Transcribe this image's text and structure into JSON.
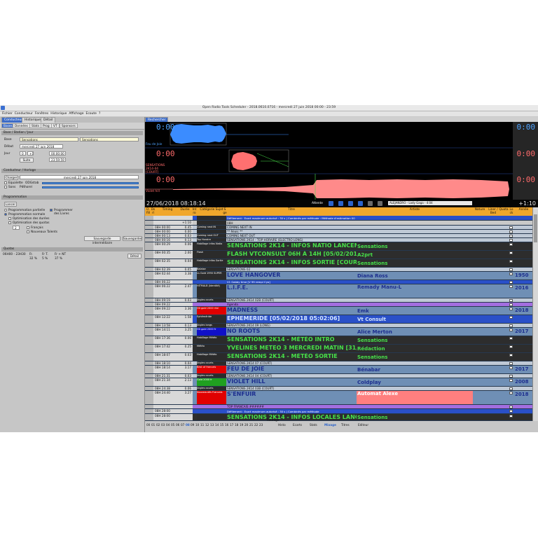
{
  "window": {
    "title": "Open Radio Tools Scheduler - 2018.0610.0716 - mercredi 27 juin 2018  00:00 - 23:59"
  },
  "menu": [
    "Fichier",
    "Conducteur",
    "Fenêtres",
    "Historique",
    "Affichage",
    "Ecoute",
    "?"
  ],
  "left": {
    "tabs": [
      "Conducteur",
      "Historique",
      "Détail"
    ],
    "subtabs": [
      "Bases",
      "Données",
      "Stats",
      "Prog",
      "VT",
      "Sponsors"
    ],
    "base_section": "Base / Station / Jour",
    "base_label": "Base",
    "base_value": "Sensations",
    "station_value": "Sensations",
    "debut_label": "Début",
    "debut_date": "mercredi 27 juin 2018",
    "jour_label": "Jour",
    "jour_val1": "0",
    "jour_val2": "+1",
    "time1": "00:00:00",
    "suite_label": "Suite",
    "time2": "23:59:59",
    "cond_section": "Conducteur / Horloge",
    "charger_label": "Charger",
    "charger_date": "mercredi 27 juin 2018",
    "check1": "Equalette",
    "check1b": "ODGstab",
    "check2": "Sons",
    "check2b": "Pdthorel",
    "prog_section": "Programmation",
    "lancer_label": "Lancer",
    "opt_partielle": "Programmation partielle",
    "opt_normale": "Programmation normale",
    "opt_durees": "Optimisation des durées",
    "opt_quotas": "Optimisation des quotas",
    "opt_livres": "Programmer des Livres",
    "num_field": "2",
    "francais": "Français",
    "nouveaux": "Nouveaux Talents",
    "sauv_inter": "Sauvegarde intermédiaire",
    "sauv": "Sauvegarder",
    "quotas_section": "Quotas",
    "quota_rows": [
      {
        "range": "06H00 - 23H30",
        "fr": "Fr.",
        "ft": "Fr T.",
        "nt": "Fr + NT"
      },
      {
        "range": "",
        "fr": "32 %",
        "ft": "5 %",
        "nt": "37 %"
      }
    ],
    "detail_btn": "Détail"
  },
  "right": {
    "tabs": [
      "Rechercher"
    ],
    "tracks": [
      {
        "label": "Feu de Joie",
        "time": "0:00",
        "rtime": "0:00"
      },
      {
        "label": "SENSATIONS 2K14-04 [COURT]",
        "time": "0:00",
        "rtime": "0:00"
      },
      {
        "label": "Violet hill",
        "time": "0:00",
        "rtime": "0:00"
      }
    ],
    "clock": "27/06/2018 08:18:14",
    "attente": "Attente",
    "song": "ALEJANDRO - Lady Gaga - 4:04",
    "plus": "+1:10",
    "headers": {
      "d": "D. fill",
      "ds": "Ds rl",
      "timing": "Timing",
      "duree": "Durée",
      "intro": "Int ro",
      "cat": "Catégorie Sujet",
      "s": "S ge",
      "titre": "Titre",
      "artiste": "Artiste",
      "nature": "Nature",
      "liner": "Liner / Bed",
      "quota": "Quota",
      "lock": "Lo ck",
      "annee": "Année"
    },
    "rows": [
      {
        "time": "",
        "dur": "",
        "cat": "",
        "title": "Défilement : Ecart maximum autorisé : 30 s | Combinés par méthode : Méthode d'estimation 00",
        "artist": "",
        "year": ""
      },
      {
        "time": "",
        "dur": "+1:10",
        "cat": "",
        "title": "08H",
        "artist": "",
        "year": ""
      },
      {
        "time": "08H 00:00",
        "dur": "0.45",
        "cat": "Coming next IN",
        "title": "COMING NEXT IN",
        "artist": "",
        "year": ""
      },
      {
        "time": "08H 00:00",
        "dur": "0.00",
        "cat": "",
        "title": "** Réalc **",
        "artist": "",
        "year": ""
      },
      {
        "time": "08H 00:13",
        "dur": "0.03",
        "cat": "Coming next OUT",
        "title": "COMING NEXT OUT",
        "artist": "",
        "year": ""
      },
      {
        "time": "08H 00:16",
        "dur": "0.13",
        "cat": "Top Horaire",
        "title": "SENSATIONS 2K14 - TOP HORAIRE (ELECTRO LONG)",
        "artist": "",
        "year": ""
      },
      {
        "time": "08H 00:29",
        "dur": "0.06",
        "cat": "Habillage infos Natio",
        "title": "SENSATIONS 2K14 - INFOS NATIO LANCEMENT",
        "artist": "Sensations",
        "year": ""
      },
      {
        "time": "08H 00:35",
        "dur": "2.00",
        "cat": "Flash",
        "title": "FLASH VTCONSULT 06H À 14H [05/02/2018 11:42]",
        "artist": "A2prt",
        "year": ""
      },
      {
        "time": "08H 02:35",
        "dur": "0.04",
        "cat": "Habillage infos Sortie",
        "title": "SENSATIONS 2K14 - INFOS SORTIE [COURT]",
        "artist": "Sensations",
        "year": ""
      },
      {
        "time": "08H 02:39",
        "dur": "0.05",
        "cat": "Balaise",
        "title": "SENSATIONS 02",
        "artist": "",
        "year": ""
      },
      {
        "time": "08H 02:44",
        "dur": "3.38",
        "cat": "Ls Gold 1990 SUPER",
        "title": "LOVE HANGOVER",
        "artist": "Diana Ross",
        "year": "1950"
      },
      {
        "time": "08H 06:22",
        "dur": "",
        "cat": "",
        "title": "V1 Gabby time [V 99 rempl Cyo]",
        "artist": "",
        "year": ""
      },
      {
        "time": "08H 06:22",
        "dur": "2.47",
        "cat": "HITMALB (Identité)",
        "title": "L.I.F.E.",
        "artist": "Remady Manu-L",
        "year": "2016"
      },
      {
        "time": "08H 09:19",
        "dur": "0.03",
        "cat": "Jingles courts",
        "title": "SENSATIONS 2K14 02B (COURT)",
        "artist": "",
        "year": ""
      },
      {
        "time": "08H 09:22",
        "dur": "",
        "cat": "",
        "title": "Agenda",
        "artist": "",
        "year": ""
      },
      {
        "time": "08H 09:22",
        "dur": "3.36",
        "cat": "Hit gold 2000 rtbl",
        "title": "MADNESS",
        "artist": "Emk",
        "year": "2018"
      },
      {
        "time": "08H 12:22",
        "dur": "1.58",
        "cat": "Ephéméride",
        "title": "EPHEMERIDE [05/02/2018 05:02:06]",
        "artist": "Vt Consult",
        "year": ""
      },
      {
        "time": "08H 13:58",
        "dur": "0.13",
        "cat": "Jingles longs",
        "title": "SENSATIONS 2K14 09 (LONG)",
        "artist": "",
        "year": ""
      },
      {
        "time": "08H 14:11",
        "dur": "3.25",
        "cat": "Hit gold 2000 fr",
        "title": "NO ROOTS",
        "artist": "Alice Merton",
        "year": "2017"
      },
      {
        "time": "08H 17:36",
        "dur": "0.06",
        "cat": "Habillage Météo",
        "title": "SENSATIONS 2K14 - MÉTÉO INTRO",
        "artist": "Sensations",
        "year": ""
      },
      {
        "time": "08H 17:42",
        "dur": "0.25",
        "cat": "Météo",
        "title": "YVELINES METEO 3 MERCREDI MATIN [31/01/2018]",
        "artist": "Rédaction",
        "year": ""
      },
      {
        "time": "08H 18:07",
        "dur": "0.03",
        "cat": "Habillage Météo",
        "title": "SENSATIONS 2K14 - MÉTÉO SORTIE",
        "artist": "Sensations",
        "year": ""
      },
      {
        "time": "08H 18:10",
        "dur": "0.04",
        "cat": "Jingles courts",
        "title": "SENSATIONS 2K14 07 (COURT)",
        "artist": "",
        "year": ""
      },
      {
        "time": "08H 18:14",
        "dur": "3.17",
        "cat": "Best of francais",
        "title": "FEU DE JOIE",
        "artist": "Bénabar",
        "year": "2017"
      },
      {
        "time": "08H 21:31",
        "dur": "0.03",
        "cat": "Jingles courts",
        "title": "SENSATIONS 2K14 04 (COURT)",
        "artist": "",
        "year": ""
      },
      {
        "time": "08H 21:34",
        "dur": "2.13",
        "cat": "Gold 2000 fr",
        "title": "VIOLET HILL",
        "artist": "Coldplay",
        "year": "2008"
      },
      {
        "time": "08H 24:38",
        "dur": "0.06",
        "cat": "Jingles courts",
        "title": "SENSATIONS 2K14 03B (COURT)",
        "artist": "",
        "year": ""
      },
      {
        "time": "08H 24:40",
        "dur": "3.27",
        "cat": "Nouveautés Francais",
        "title": "S'ENFUIR",
        "artist": "Automat Alexe",
        "year": "2018"
      },
      {
        "time": "",
        "dur": "",
        "cat": "",
        "title": "TOP FRANCAIS ######",
        "artist": "",
        "year": ""
      },
      {
        "time": "08H 28:00",
        "dur": "",
        "cat": "",
        "title": "Défilement : Ecart maximum autorisé : 30 s | Combinés par méthode",
        "artist": "",
        "year": ""
      },
      {
        "time": "08H 28:00",
        "dur": "",
        "cat": "",
        "title": "SENSATIONS 2K14 - INFOS LOCALES LANCEMENT",
        "artist": "Sensations",
        "year": ""
      }
    ],
    "bottom_hours": [
      "00",
      "01",
      "02",
      "03",
      "04",
      "05",
      "06",
      "07",
      "08",
      "09",
      "10",
      "11",
      "12",
      "13",
      "14",
      "15",
      "16",
      "17",
      "18",
      "19",
      "20",
      "21",
      "22",
      "23"
    ],
    "bottom_tabs": [
      "Routage",
      "Histo",
      "Ecarts",
      "Stats",
      "Mixage",
      "Titres",
      "Editeur"
    ]
  },
  "colors": {
    "accent": "#3d6cc7",
    "header": "#f0a72c",
    "waveBlue": "#3b8cff",
    "waveRed": "#ff7070",
    "green": "#47e04a"
  }
}
